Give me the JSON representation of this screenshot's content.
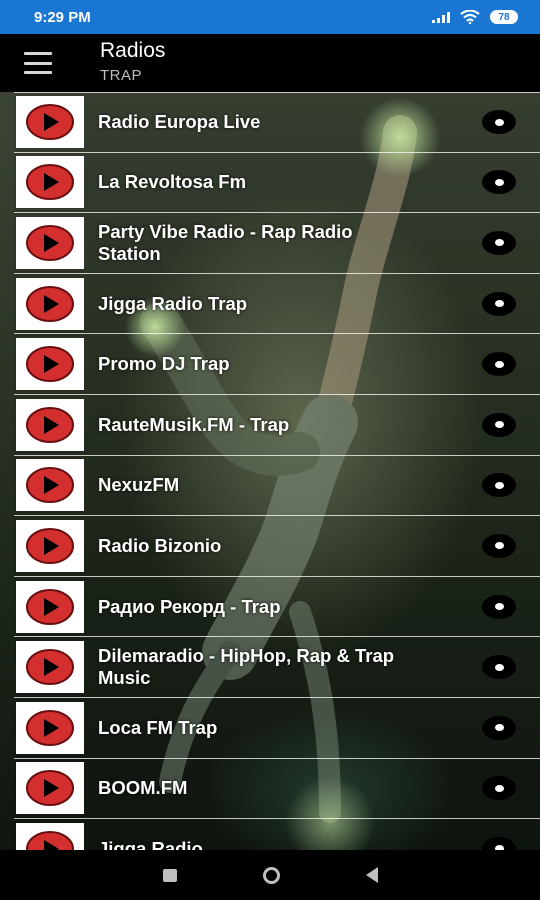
{
  "status_bar": {
    "time": "9:29 PM",
    "battery": "78",
    "icons": [
      "signal-icon",
      "wifi-icon",
      "battery-icon"
    ],
    "background": "#1976d2"
  },
  "app_bar": {
    "title": "Radios",
    "subtitle": "TRAP",
    "menu_icon": "hamburger-menu-icon"
  },
  "stations": [
    {
      "name": "Radio Europa Live"
    },
    {
      "name": "La Revoltosa Fm"
    },
    {
      "name": "Party Vibe Radio - Rap Radio Station"
    },
    {
      "name": "Jigga Radio Trap"
    },
    {
      "name": "Promo DJ Trap"
    },
    {
      "name": "RauteMusik.FM - Trap"
    },
    {
      "name": "NexuzFM"
    },
    {
      "name": "Radio Bizonio"
    },
    {
      "name": "Радио Рекорд - Trap"
    },
    {
      "name": "Dilemaradio - HipHop, Rap & Trap Music"
    },
    {
      "name": "Loca FM Trap"
    },
    {
      "name": "BOOM.FM"
    },
    {
      "name": "Jigga Radio"
    }
  ],
  "row_icons": {
    "thumbnail": "play-icon",
    "action": "dot-icon"
  },
  "colors": {
    "play_red": "#d32f2f",
    "app_bar": "#000000"
  },
  "nav_bar": {
    "icons": [
      "recents-square-icon",
      "home-circle-icon",
      "back-triangle-icon"
    ]
  }
}
